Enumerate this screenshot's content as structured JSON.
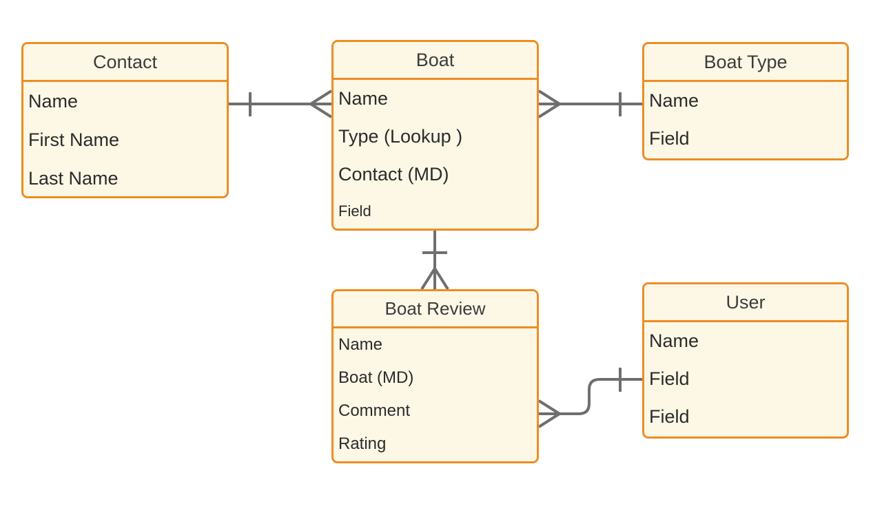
{
  "diagram": {
    "type": "entity-relationship-diagram",
    "notation": "crows-foot",
    "colors": {
      "entity_border": "#EE8C22",
      "entity_fill": "#FDF8E6",
      "connector": "#6E6E6E",
      "title_text": "#3C3C3C",
      "attribute_text": "#2B2B2B",
      "background": "#FFFFFF"
    },
    "entities": [
      {
        "id": "contact",
        "title": "Contact",
        "attributes": [
          "Name",
          "First Name",
          "Last Name"
        ]
      },
      {
        "id": "boat",
        "title": "Boat",
        "attributes": [
          "Name",
          "Type (Lookup )",
          "Contact (MD)",
          "Field"
        ]
      },
      {
        "id": "boat_type",
        "title": "Boat Type",
        "attributes": [
          "Name",
          "Field"
        ]
      },
      {
        "id": "boat_review",
        "title": "Boat Review",
        "attributes": [
          "Name",
          "Boat (MD)",
          "Comment",
          "Rating"
        ]
      },
      {
        "id": "user",
        "title": "User",
        "attributes": [
          "Name",
          "Field",
          "Field"
        ]
      }
    ],
    "relationships": [
      {
        "id": "contact-boat",
        "from": "contact",
        "to": "boat",
        "from_cardinality": "one",
        "to_cardinality": "many"
      },
      {
        "id": "boat-boat-type",
        "from": "boat",
        "to": "boat_type",
        "from_cardinality": "many",
        "to_cardinality": "one"
      },
      {
        "id": "boat-boat-review",
        "from": "boat",
        "to": "boat_review",
        "from_cardinality": "one",
        "to_cardinality": "many"
      },
      {
        "id": "boat-review-user",
        "from": "boat_review",
        "to": "user",
        "from_cardinality": "many",
        "to_cardinality": "one"
      }
    ]
  }
}
